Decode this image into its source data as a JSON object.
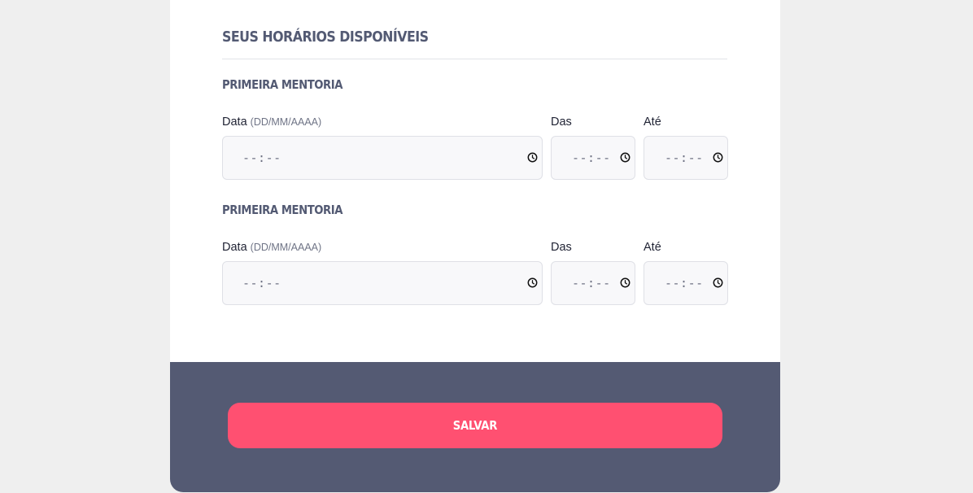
{
  "section": {
    "title": "SEUS HORÁRIOS DISPONÍVEIS"
  },
  "slots": [
    {
      "title": "PRIMEIRA MENTORIA",
      "date_label": "Data",
      "date_hint": "(DD/MM/AAAA)",
      "date_value": "--:--",
      "from_label": "Das",
      "from_value": "--:--",
      "to_label": "Até",
      "to_value": "--:--"
    },
    {
      "title": "PRIMEIRA MENTORIA",
      "date_label": "Data",
      "date_hint": "(DD/MM/AAAA)",
      "date_value": "--:--",
      "from_label": "Das",
      "from_value": "--:--",
      "to_label": "Até",
      "to_value": "--:--"
    }
  ],
  "footer": {
    "save_label": "SALVAR"
  },
  "icons": {
    "time_picker": "clock-icon"
  },
  "colors": {
    "background": "#efefef",
    "card": "#ffffff",
    "heading": "#535a73",
    "footer": "#545a73",
    "accent": "#ff5071",
    "input_bg": "#f8f8fa",
    "input_border": "#dfe0e6",
    "error_border": "#e0314b"
  }
}
